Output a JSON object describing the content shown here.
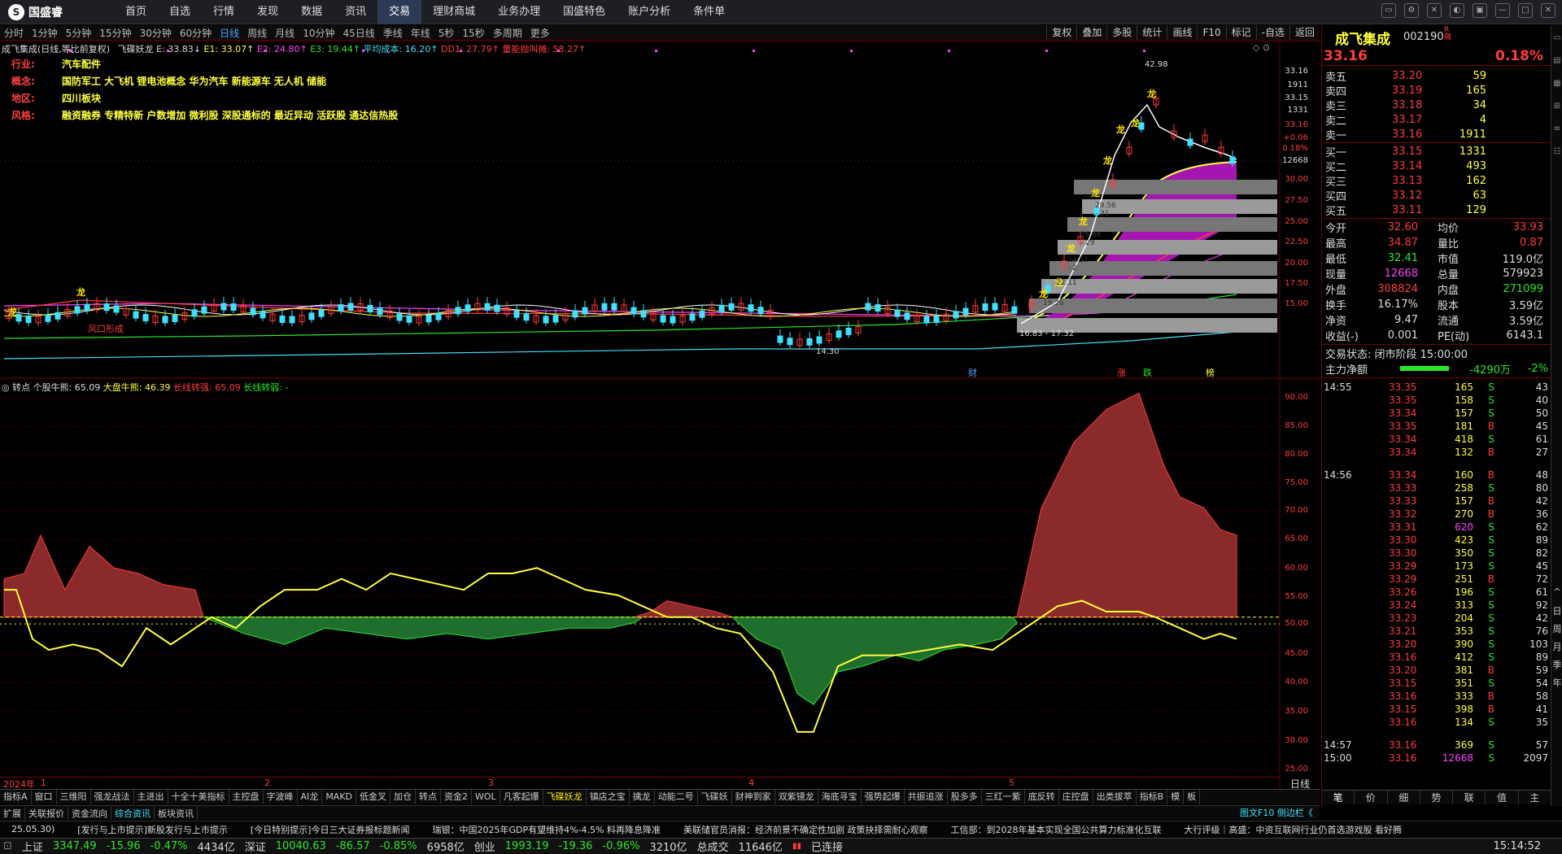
{
  "app": {
    "logo_text": "国盛睿"
  },
  "menu": [
    "首页",
    "自选",
    "行情",
    "发现",
    "数据",
    "资讯",
    "交易",
    "理财商城",
    "业务办理",
    "国盛特色",
    "账户分析",
    "条件单"
  ],
  "menu_active": 6,
  "periods": [
    "分时",
    "1分钟",
    "5分钟",
    "15分钟",
    "30分钟",
    "60分钟",
    "日线",
    "周线",
    "月线",
    "10分钟",
    "45日线",
    "季线",
    "年线",
    "5秒",
    "15秒",
    "多周期",
    "更多"
  ],
  "period_active": 6,
  "toolbar_right": [
    "复权",
    "叠加",
    "多股",
    "统计",
    "画线",
    "F10",
    "标记",
    "-自选",
    "返回"
  ],
  "main_legend": {
    "title": "成飞集成(日线,等比前复权)",
    "ind": "飞碟妖龙",
    "E": "E: 33.83↓",
    "E1": "E1: 33.07↑",
    "E2": "E2: 24.80↑",
    "E3": "E3: 19.44↑",
    "avg": "平均成本: 16.20↑",
    "dd1": "DD1: 27.79↑",
    "sup": "量能抛叫摊: 58.27↑"
  },
  "info_lines": [
    {
      "k": "行业:",
      "v": "汽车配件"
    },
    {
      "k": "概念:",
      "v": "国防军工 大飞机 锂电池概念 华为汽车 新能源车 无人机 储能"
    },
    {
      "k": "地区:",
      "v": "四川板块"
    },
    {
      "k": "风格:",
      "v": "融资融券 专精特新 户数增加 微利股 深股通标的 最近异动 活跃股 通达信热股"
    }
  ],
  "main_axis": [
    "33.16",
    "1911",
    "33.15",
    "1331",
    "33.16",
    "+0.06",
    "0.18%",
    "12668",
    "30.00",
    "27.50",
    "25.00",
    "22.50",
    "20.00",
    "17.50",
    "15.00"
  ],
  "main_annotations": {
    "high": "42.98",
    "low": "14.30",
    "label1": "16.83 - 17.32",
    "bands": [
      "29.56 - 31",
      "26.66 - 29",
      "24.51 - 2",
      "22.11",
      "19.26"
    ],
    "window": "风口形成",
    "events": [
      "财",
      "涨",
      "跌",
      "榜"
    ]
  },
  "sub_legend": {
    "name": "转点",
    "a": "个股牛熊: 65.09",
    "b": "大盘牛熊: 46.39",
    "c": "长线转强: 65.09",
    "d": "长线转弱: -"
  },
  "sub_axis": [
    "90.00",
    "85.00",
    "80.00",
    "75.00",
    "70.00",
    "65.00",
    "60.00",
    "55.00",
    "50.00",
    "45.00",
    "40.00",
    "35.00",
    "30.00",
    "25.00"
  ],
  "date_axis": [
    "2024年",
    "1",
    "2",
    "3",
    "4",
    "5"
  ],
  "date_axis_right": "日线",
  "tabs": [
    "指标A",
    "窗口",
    "三维阳",
    "强龙战法",
    "主进出",
    "十全十美指标",
    "主控盘",
    "字波峰",
    "AI龙",
    "MAKD",
    "低金叉",
    "加仓",
    "转点",
    "资金2",
    "WOL",
    "凡客起爆",
    "飞碟妖龙",
    "镇店之宝",
    "擒龙",
    "动能二号",
    "飞碟妖",
    "财神到家",
    "双紫镜龙",
    "海底寻宝",
    "强势起爆",
    "共振追涨",
    "股多多",
    "三红一紫",
    "底反转",
    "庄控盘",
    "出类拔萃",
    "指标B",
    "模",
    "板"
  ],
  "tab_active": 16,
  "tabs2": [
    "扩展",
    "关联报价",
    "资金流向",
    "综合资讯",
    "板块资讯"
  ],
  "tabs2_active": 3,
  "tabs2_right": "图文F10 侧边栏《",
  "right": {
    "name": "成飞集成",
    "code": "002190",
    "tag": "R 融",
    "price": "33.16",
    "pct": "0.18%",
    "asks": [
      [
        "卖五",
        "33.20",
        "59"
      ],
      [
        "卖四",
        "33.19",
        "165"
      ],
      [
        "卖三",
        "33.18",
        "34"
      ],
      [
        "卖二",
        "33.17",
        "4"
      ],
      [
        "卖一",
        "33.16",
        "1911"
      ]
    ],
    "bids": [
      [
        "买一",
        "33.15",
        "1331"
      ],
      [
        "买二",
        "33.14",
        "493"
      ],
      [
        "买三",
        "33.13",
        "162"
      ],
      [
        "买四",
        "33.12",
        "63"
      ],
      [
        "买五",
        "33.11",
        "129"
      ]
    ],
    "stats": [
      [
        "今开",
        "32.60",
        "均价",
        "33.93"
      ],
      [
        "最高",
        "34.87",
        "量比",
        "0.87"
      ],
      [
        "最低",
        "32.41",
        "市值",
        "119.0亿"
      ],
      [
        "现量",
        "12668",
        "总量",
        "579923"
      ],
      [
        "外盘",
        "308824",
        "内盘",
        "271099"
      ],
      [
        "换手",
        "16.17%",
        "股本",
        "3.59亿"
      ],
      [
        "净资",
        "9.47",
        "流通",
        "3.59亿"
      ],
      [
        "收益(-)",
        "0.001",
        "PE(动)",
        "6143.1"
      ]
    ],
    "status": "交易状态: 闭市阶段 15:00:00",
    "flow_label": "主力净额",
    "flow_val": "-4290万",
    "flow_pct": "-2%",
    "ticks": [
      [
        "14:55",
        "33.35",
        "165",
        "S",
        "43"
      ],
      [
        "",
        "33.35",
        "158",
        "S",
        "40"
      ],
      [
        "",
        "33.34",
        "157",
        "S",
        "50"
      ],
      [
        "",
        "33.35",
        "181",
        "B",
        "45"
      ],
      [
        "",
        "33.34",
        "418",
        "S",
        "61"
      ],
      [
        "",
        "33.34",
        "132",
        "B",
        "27"
      ],
      [
        "14:56",
        "33.34",
        "160",
        "B",
        "48"
      ],
      [
        "",
        "33.33",
        "258",
        "S",
        "80"
      ],
      [
        "",
        "33.33",
        "157",
        "B",
        "42"
      ],
      [
        "",
        "33.32",
        "270",
        "B",
        "36"
      ],
      [
        "",
        "33.31",
        "620",
        "S",
        "62"
      ],
      [
        "",
        "33.30",
        "423",
        "S",
        "89"
      ],
      [
        "",
        "33.30",
        "350",
        "S",
        "82"
      ],
      [
        "",
        "33.29",
        "173",
        "S",
        "45"
      ],
      [
        "",
        "33.29",
        "251",
        "B",
        "72"
      ],
      [
        "",
        "33.26",
        "196",
        "S",
        "61"
      ],
      [
        "",
        "33.24",
        "313",
        "S",
        "92"
      ],
      [
        "",
        "33.23",
        "204",
        "S",
        "42"
      ],
      [
        "",
        "33.21",
        "353",
        "S",
        "76"
      ],
      [
        "",
        "33.20",
        "390",
        "S",
        "103"
      ],
      [
        "",
        "33.16",
        "412",
        "S",
        "89"
      ],
      [
        "",
        "33.20",
        "381",
        "B",
        "59"
      ],
      [
        "",
        "33.15",
        "351",
        "S",
        "54"
      ],
      [
        "",
        "33.16",
        "333",
        "B",
        "58"
      ],
      [
        "",
        "33.15",
        "398",
        "B",
        "41"
      ],
      [
        "",
        "33.16",
        "134",
        "S",
        "35"
      ],
      [
        "14:57",
        "33.16",
        "369",
        "S",
        "57"
      ],
      [
        "15:00",
        "33.16",
        "12668",
        "S",
        "2097"
      ]
    ],
    "bottom_tabs": [
      "笔",
      "价",
      "细",
      "势",
      "联",
      "值",
      "主"
    ],
    "side_buttons": [
      "^",
      "日",
      "周",
      "月",
      "季",
      "年"
    ]
  },
  "news": [
    "25.05.30)",
    "[发行与上市提示]新股发行与上市提示",
    "[今日特别提示]今日三大证券报标题新闻",
    "瑞银：中国2025年GDP有望维持4%-4.5% 料再降息降准",
    "美联储官员消报：经济前景不确定性加剧 政策抉择需耐心观察",
    "工信部：到2028年基本实现全国公共算力标准化互联",
    "大行评级｜高盛：中资互联网行业仍首选游戏股 看好腾"
  ],
  "indices": [
    {
      "name": "上证",
      "v": "3347.49",
      "c": "-15.96",
      "p": "-0.47%",
      "a": "4434亿"
    },
    {
      "name": "深证",
      "v": "10040.63",
      "c": "-86.57",
      "p": "-0.85%",
      "a": "6958亿"
    },
    {
      "name": "创业",
      "v": "1993.19",
      "c": "-19.36",
      "p": "-0.96%",
      "a": "3210亿"
    }
  ],
  "total_label": "总成交",
  "total_val": "11646亿",
  "conn": "已连接",
  "clock": "15:14:52"
}
